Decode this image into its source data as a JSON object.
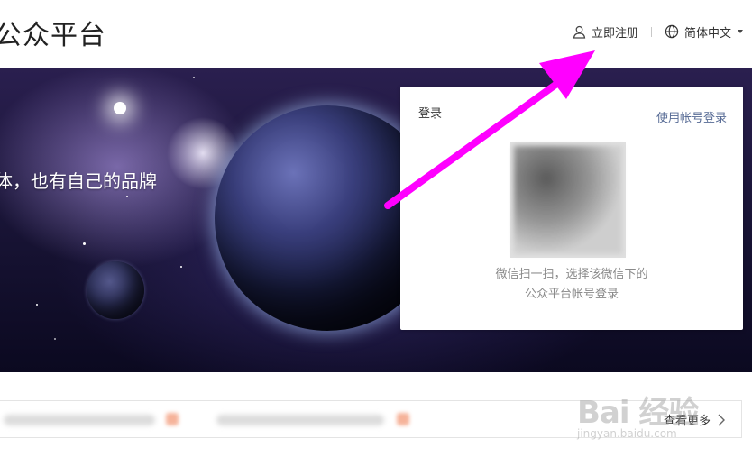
{
  "header": {
    "site_title": "公众平台",
    "register_label": "立即注册",
    "register_icon": "user-icon",
    "language_label": "简体中文",
    "language_icon": "globe-icon"
  },
  "banner": {
    "slogan": "体，也有自己的品牌"
  },
  "login": {
    "title": "登录",
    "switch_label": "使用帐号登录",
    "qr_hint_line1": "微信扫一扫，选择该微信下的",
    "qr_hint_line2": "公众平台帐号登录"
  },
  "notice": {
    "more_label": "查看更多",
    "more_icon": "chevron-right-icon"
  },
  "watermark": {
    "big": "Bai 经验",
    "small": "jingyan.baidu.com"
  },
  "colors": {
    "link": "#576b95",
    "annotation_arrow": "#ff00ff"
  }
}
